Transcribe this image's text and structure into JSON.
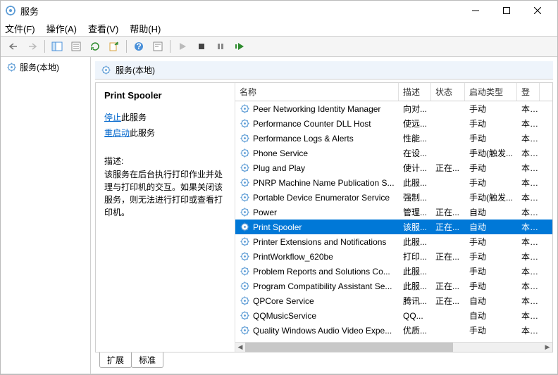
{
  "window": {
    "title": "服务"
  },
  "menu": {
    "file": "文件(F)",
    "action": "操作(A)",
    "view": "查看(V)",
    "help": "帮助(H)"
  },
  "leftPane": {
    "root": "服务(本地)"
  },
  "rightHead": {
    "title": "服务(本地)"
  },
  "detail": {
    "serviceName": "Print Spooler",
    "stopLink": "停止",
    "stopSuffix": "此服务",
    "restartLink": "重启动",
    "restartSuffix": "此服务",
    "descLabel": "描述:",
    "descText": "该服务在后台执行打印作业并处理与打印机的交互。如果关闭该服务，则无法进行打印或查看打印机。"
  },
  "columns": {
    "name": "名称",
    "desc": "描述",
    "status": "状态",
    "startup": "启动类型",
    "logon": "登"
  },
  "rows": [
    {
      "name": "Peer Networking Identity Manager",
      "desc": "向对...",
      "status": "",
      "startup": "手动",
      "logon": "本..."
    },
    {
      "name": "Performance Counter DLL Host",
      "desc": "使远...",
      "status": "",
      "startup": "手动",
      "logon": "本..."
    },
    {
      "name": "Performance Logs & Alerts",
      "desc": "性能...",
      "status": "",
      "startup": "手动",
      "logon": "本..."
    },
    {
      "name": "Phone Service",
      "desc": "在设...",
      "status": "",
      "startup": "手动(触发...",
      "logon": "本..."
    },
    {
      "name": "Plug and Play",
      "desc": "使计...",
      "status": "正在...",
      "startup": "手动",
      "logon": "本..."
    },
    {
      "name": "PNRP Machine Name Publication S...",
      "desc": "此服...",
      "status": "",
      "startup": "手动",
      "logon": "本..."
    },
    {
      "name": "Portable Device Enumerator Service",
      "desc": "强制...",
      "status": "",
      "startup": "手动(触发...",
      "logon": "本..."
    },
    {
      "name": "Power",
      "desc": "管理...",
      "status": "正在...",
      "startup": "自动",
      "logon": "本..."
    },
    {
      "name": "Print Spooler",
      "desc": "该服...",
      "status": "正在...",
      "startup": "自动",
      "logon": "本...",
      "selected": true
    },
    {
      "name": "Printer Extensions and Notifications",
      "desc": "此服...",
      "status": "",
      "startup": "手动",
      "logon": "本..."
    },
    {
      "name": "PrintWorkflow_620be",
      "desc": "打印...",
      "status": "正在...",
      "startup": "手动",
      "logon": "本..."
    },
    {
      "name": "Problem Reports and Solutions Co...",
      "desc": "此服...",
      "status": "",
      "startup": "手动",
      "logon": "本..."
    },
    {
      "name": "Program Compatibility Assistant Se...",
      "desc": "此服...",
      "status": "正在...",
      "startup": "手动",
      "logon": "本..."
    },
    {
      "name": "QPCore Service",
      "desc": "腾讯...",
      "status": "正在...",
      "startup": "自动",
      "logon": "本..."
    },
    {
      "name": "QQMusicService",
      "desc": "QQ...",
      "status": "",
      "startup": "自动",
      "logon": "本..."
    },
    {
      "name": "Quality Windows Audio Video Expe...",
      "desc": "优质...",
      "status": "",
      "startup": "手动",
      "logon": "本..."
    }
  ],
  "tabs": {
    "extended": "扩展",
    "standard": "标准"
  }
}
